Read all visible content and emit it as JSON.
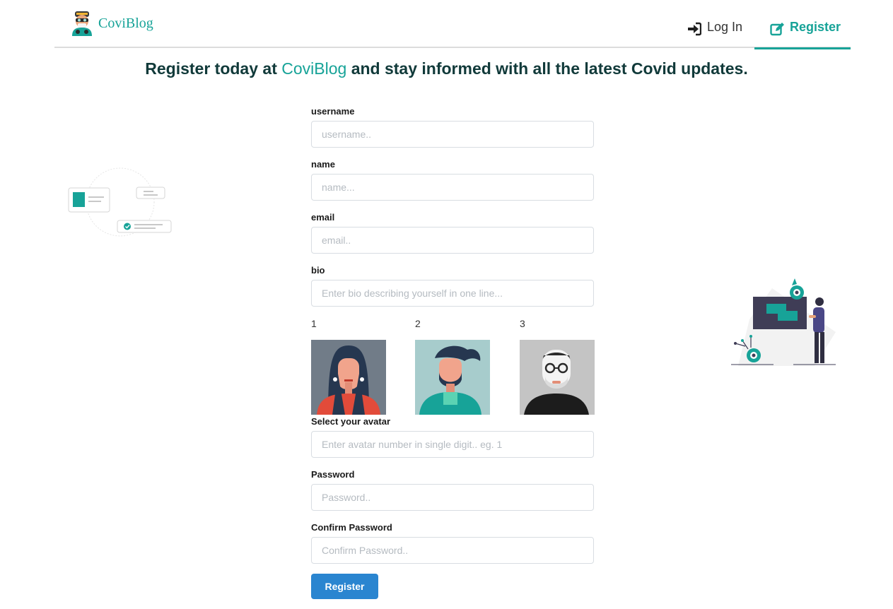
{
  "brand": {
    "name": "CoviBlog"
  },
  "nav": {
    "login_label": "Log In",
    "register_label": "Register"
  },
  "headline": {
    "prefix": "Register today at",
    "accent": "CoviBlog",
    "suffix": "and stay informed with all the latest Covid updates."
  },
  "form": {
    "username": {
      "label": "username",
      "placeholder": "username.."
    },
    "name": {
      "label": "name",
      "placeholder": "name..."
    },
    "email": {
      "label": "email",
      "placeholder": "email.."
    },
    "bio": {
      "label": "bio",
      "placeholder": "Enter bio describing yourself in one line..."
    },
    "avatars": [
      {
        "number": "1"
      },
      {
        "number": "2"
      },
      {
        "number": "3"
      }
    ],
    "avatar_select": {
      "label": "Select your avatar",
      "placeholder": "Enter avatar number in single digit.. eg. 1"
    },
    "password": {
      "label": "Password",
      "placeholder": "Password.."
    },
    "confirm_password": {
      "label": "Confirm Password",
      "placeholder": "Confirm Password.."
    },
    "submit_label": "Register"
  },
  "colors": {
    "accent": "#17a398",
    "button": "#2a85d0",
    "heading": "#113a3a"
  }
}
